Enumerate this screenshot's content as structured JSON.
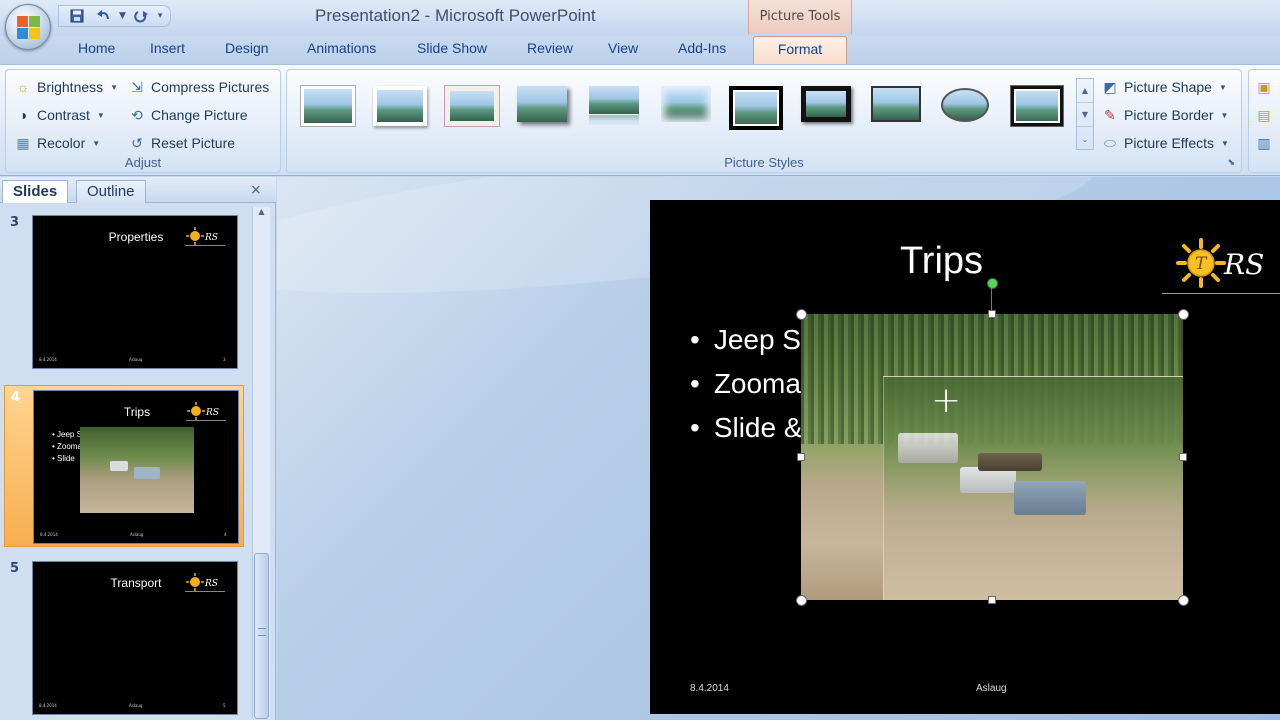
{
  "window": {
    "title": "Presentation2 - Microsoft PowerPoint",
    "context_tab_label": "Picture Tools"
  },
  "tabs": [
    "Home",
    "Insert",
    "Design",
    "Animations",
    "Slide Show",
    "Review",
    "View",
    "Add-Ins"
  ],
  "active_tab": "Format",
  "ribbon": {
    "adjust": {
      "label": "Adjust",
      "brightness": "Brightness",
      "contrast": "Contrast",
      "recolor": "Recolor",
      "compress": "Compress Pictures",
      "change": "Change Picture",
      "reset": "Reset Picture"
    },
    "styles": {
      "label": "Picture Styles",
      "shape": "Picture Shape",
      "border": "Picture Border",
      "effects": "Picture Effects"
    }
  },
  "slides_pane": {
    "tab_slides": "Slides",
    "tab_outline": "Outline",
    "close": "×",
    "thumbs": [
      {
        "number": "3",
        "title": "Properties",
        "bullets": [],
        "footer_date": "8.4.2014",
        "footer_author": "Aslaug",
        "footer_page": "3"
      },
      {
        "number": "4",
        "title": "Trips",
        "bullets": [
          "Jeep S",
          "Zooma",
          "Slide"
        ],
        "footer_date": "8.4.2014",
        "footer_author": "Aslaug",
        "footer_page": "4"
      },
      {
        "number": "5",
        "title": "Transport",
        "bullets": [],
        "footer_date": "8.4.2014",
        "footer_author": "Aslaug",
        "footer_page": "5"
      }
    ]
  },
  "slide": {
    "title": "Trips",
    "bullets": [
      "Jeep S",
      "Zooma",
      "Slide &"
    ],
    "footer_date": "8.4.2014",
    "footer_author": "Aslaug",
    "logo_text": "RS",
    "logo_letter": "T"
  },
  "colors": {
    "ribbon_blue": "#15428b",
    "context_accent": "#f7dcc9",
    "active_slide": "#f8ae4e"
  }
}
